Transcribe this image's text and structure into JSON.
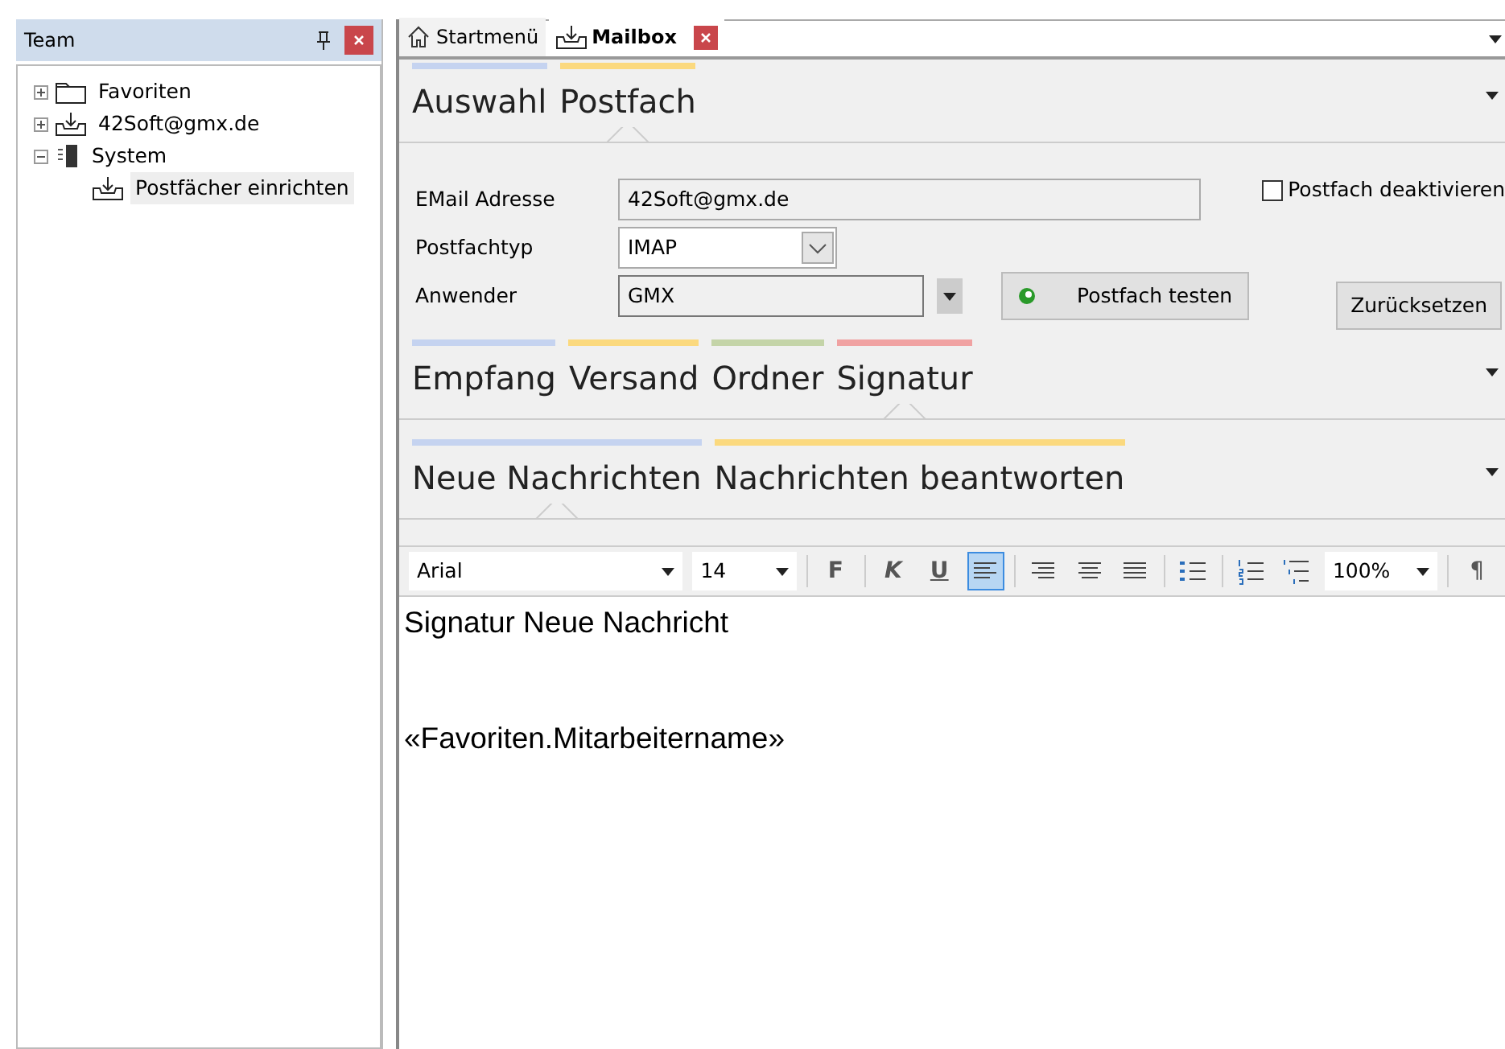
{
  "team_panel": {
    "title": "Team",
    "tree": [
      {
        "label": "Favoriten",
        "kind": "folder",
        "expanded": false,
        "selected": false
      },
      {
        "label": "42Soft@gmx.de",
        "kind": "mailbox",
        "expanded": false,
        "selected": false
      },
      {
        "label": "System",
        "kind": "system",
        "expanded": true,
        "selected": false,
        "children": [
          {
            "label": "Postfächer einrichten",
            "kind": "mailbox",
            "selected": true
          }
        ]
      }
    ]
  },
  "doc_tabs": [
    {
      "label": "Startmenü",
      "kind": "start",
      "selected": false,
      "closable": false
    },
    {
      "label": "Mailbox",
      "kind": "mailbox",
      "selected": true,
      "closable": true
    }
  ],
  "pivot_main": [
    {
      "label": "Auswahl",
      "color": "#c5d3f0",
      "selected": false
    },
    {
      "label": "Postfach",
      "color": "#fbd97e",
      "selected": true
    }
  ],
  "form": {
    "fields": [
      {
        "kind": "text",
        "label": "EMail Adresse",
        "value": "42Soft@gmx.de"
      },
      {
        "kind": "select",
        "label": "Postfachtyp",
        "value": "IMAP"
      },
      {
        "kind": "combo",
        "label": "Anwender",
        "value": "GMX"
      }
    ],
    "checkbox": {
      "label": "Postfach deaktivieren",
      "checked": false
    },
    "test_button": "Postfach testen",
    "reset_button": "Zurücksetzen"
  },
  "pivot_sub": [
    {
      "label": "Empfang",
      "color": "#c5d3f0",
      "selected": false
    },
    {
      "label": "Versand",
      "color": "#fbd97e",
      "selected": false
    },
    {
      "label": "Ordner",
      "color": "#c4d4a8",
      "selected": false
    },
    {
      "label": "Signatur",
      "color": "#f0a2a2",
      "selected": true
    }
  ],
  "pivot_sig": [
    {
      "label": "Neue Nachrichten",
      "color": "#c5d3f0",
      "selected": true
    },
    {
      "label": "Nachrichten beantworten",
      "color": "#fbd97e",
      "selected": false
    }
  ],
  "toolbar": {
    "font": "Arial",
    "size": "14",
    "zoom": "100%",
    "buttons": [
      {
        "kind": "bold",
        "label": "F",
        "selected": false
      },
      {
        "kind": "italic",
        "label": "K",
        "selected": false
      },
      {
        "kind": "underline",
        "label": "U",
        "selected": false
      },
      {
        "kind": "align-left",
        "selected": true
      },
      {
        "kind": "align-right",
        "selected": false
      },
      {
        "kind": "align-center",
        "selected": false
      },
      {
        "kind": "align-justify",
        "selected": false
      },
      {
        "kind": "bullet-list",
        "selected": false
      },
      {
        "kind": "numbered-list",
        "selected": false
      },
      {
        "kind": "multilevel-list",
        "selected": false
      }
    ],
    "pilcrow": "¶"
  },
  "editor": {
    "lines": [
      "Signatur Neue Nachricht",
      "«Favoriten.Mitarbeitername»"
    ]
  }
}
